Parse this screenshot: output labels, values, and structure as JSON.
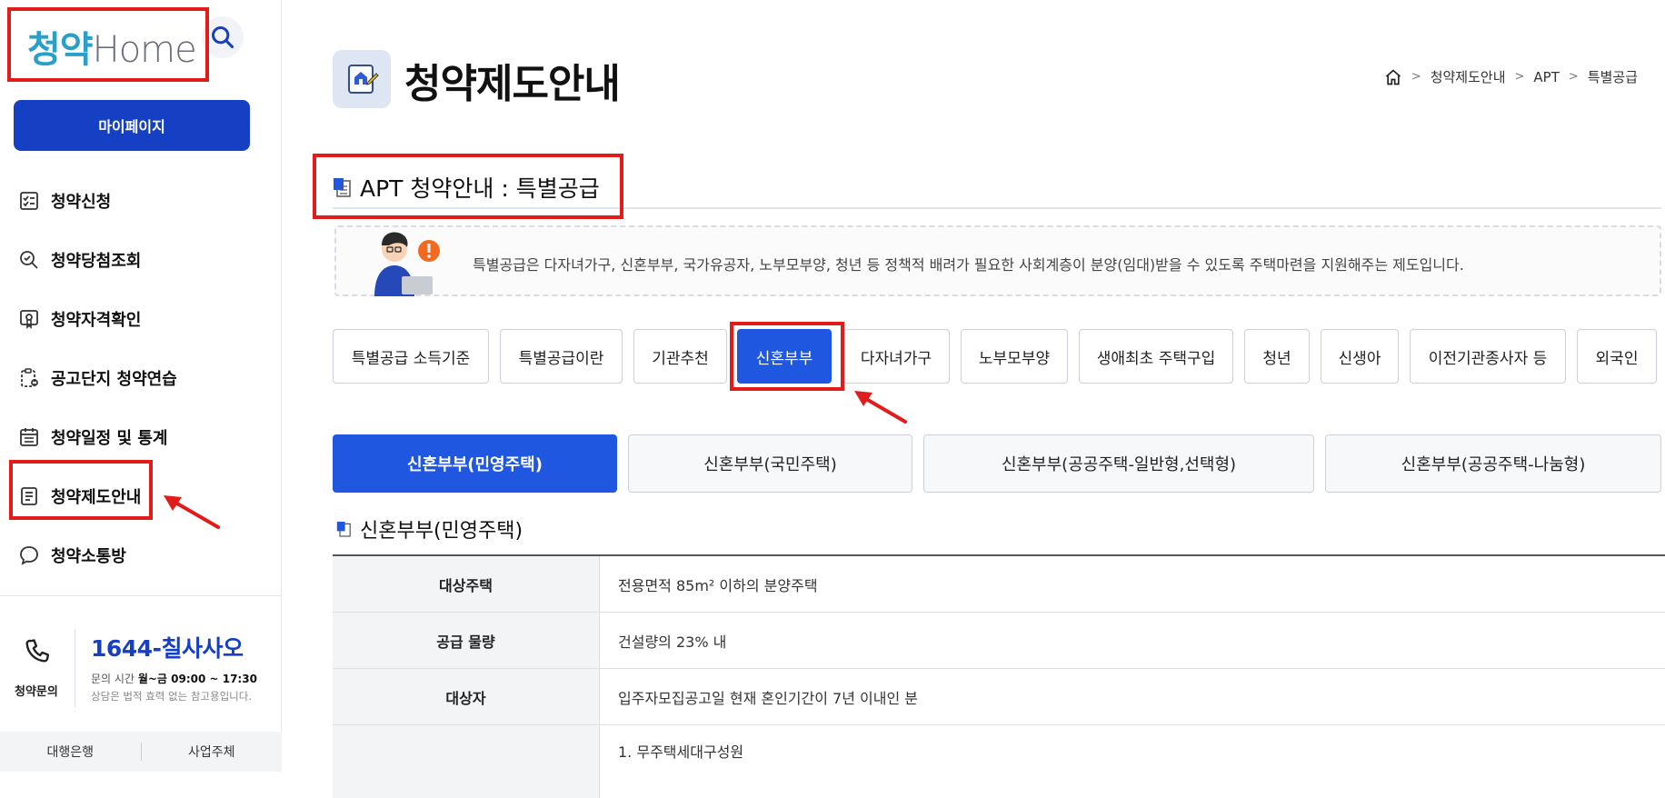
{
  "sidebar": {
    "logo_prefix": "청약",
    "logo_suffix": "Home",
    "mypage_label": "마이페이지",
    "menu": [
      {
        "label": "청약신청",
        "icon": "checklist-icon"
      },
      {
        "label": "청약당첨조회",
        "icon": "magnify-check-icon"
      },
      {
        "label": "청약자격확인",
        "icon": "certificate-icon"
      },
      {
        "label": "공고단지 청약연습",
        "icon": "practice-icon"
      },
      {
        "label": "청약일정 및 통계",
        "icon": "calendar-list-icon"
      },
      {
        "label": "청약제도안내",
        "icon": "guide-document-icon"
      },
      {
        "label": "청약소통방",
        "icon": "chat-bubble-icon"
      }
    ],
    "contact": {
      "label": "청약문의",
      "number": "1644-칠사사오",
      "hours_prefix": "문의 시간",
      "hours_value": "월~금 09:00 ~ 17:30",
      "note": "상담은 법적 효력 없는 참고용입니다."
    },
    "bottom_tabs": [
      "대행은행",
      "사업주체"
    ]
  },
  "header": {
    "title": "청약제도안내",
    "breadcrumb": [
      "청약제도안내",
      "APT",
      "특별공급"
    ]
  },
  "section": {
    "title": "APT 청약안내 : 특별공급",
    "info": "특별공급은 다자녀가구, 신혼부부, 국가유공자, 노부모부양, 청년 등 정책적 배려가 필요한 사회계층이 분양(임대)받을 수 있도록 주택마련을 지원해주는 제도입니다."
  },
  "tabs": [
    "특별공급 소득기준",
    "특별공급이란",
    "기관추천",
    "신혼부부",
    "다자녀가구",
    "노부모부양",
    "생애최초 주택구입",
    "청년",
    "신생아",
    "이전기관종사자 등",
    "외국인"
  ],
  "active_tab": "신혼부부",
  "subtabs": [
    "신혼부부(민영주택)",
    "신혼부부(국민주택)",
    "신혼부부(공공주택-일반형,선택형)",
    "신혼부부(공공주택-나눔형)"
  ],
  "active_subtab": "신혼부부(민영주택)",
  "sub_title": "신혼부부(민영주택)",
  "table": {
    "rows": [
      {
        "header": "대상주택",
        "value": "전용면적 85m² 이하의 분양주택"
      },
      {
        "header": "공급 물량",
        "value": "건설량의 23% 내"
      },
      {
        "header": "대상자",
        "value": "입주자모집공고일 현재 혼인기간이 7년 이내인 분"
      },
      {
        "header": "",
        "value": "1. 무주택세대구성원"
      }
    ]
  },
  "colors": {
    "primary": "#1640c4",
    "active_tab": "#1f57e0",
    "highlight": "#e21b1b"
  }
}
